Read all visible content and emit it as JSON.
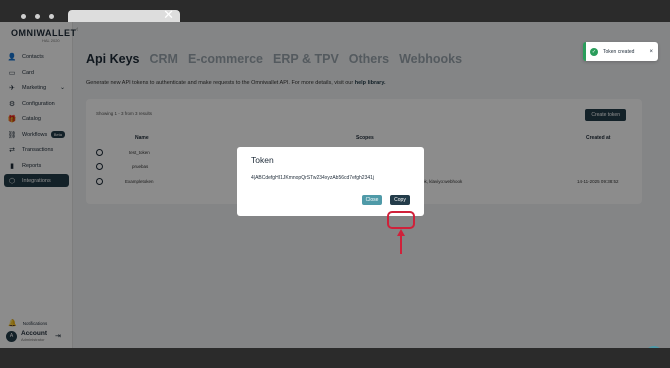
{
  "browser": {
    "tab_close": "✕"
  },
  "sidebar": {
    "logo": "OMNIWALLET",
    "logo_sub": "HAL 2020",
    "collapse": "‹",
    "items": [
      {
        "label": "Contacts",
        "icon": "👤"
      },
      {
        "label": "Card",
        "icon": "▭"
      },
      {
        "label": "Marketing",
        "icon": "✈"
      },
      {
        "label": "Configuration",
        "icon": "⚙"
      },
      {
        "label": "Catalog",
        "icon": "🎁"
      },
      {
        "label": "Workflows",
        "icon": "⛓",
        "badge": "Beta"
      },
      {
        "label": "Transactions",
        "icon": "⇄"
      },
      {
        "label": "Reports",
        "icon": "▮"
      },
      {
        "label": "Integrations",
        "icon": "⬡"
      }
    ],
    "notifications": "Notifications",
    "account_name": "Account",
    "account_role": "Administrator"
  },
  "main": {
    "tabs": [
      "Api Keys",
      "CRM",
      "E-commerce",
      "ERP & TPV",
      "Others",
      "Webhooks"
    ],
    "description": "Generate new API tokens to authenticate and make requests to the Omniwallet API. For more details, visit our ",
    "help_link": "help library.",
    "showing": "Showing 1 - 3 from 3 results",
    "create_token": "Create token",
    "headers": {
      "name": "Name",
      "scopes": "Scopes",
      "created_at": "Created at"
    },
    "rows": [
      {
        "name": "test_token",
        "scopes": "",
        "created": ""
      },
      {
        "name": "pruebas",
        "scopes": "",
        "created": ""
      },
      {
        "name": "Exampletoken",
        "scopes": "ok, klaviyo:webhook",
        "created": "14-11-2025 09:38:52"
      }
    ]
  },
  "toast": {
    "text": "Token created",
    "close": "×"
  },
  "modal": {
    "title": "Token",
    "token": "4|ABCdefgHI1JKmnopQrSTw234xyzAb56cd7efgh2341j",
    "close_label": "Close",
    "copy_label": "Copy"
  },
  "colors": {
    "accent": "#233c4a",
    "teal": "#4f9aa8",
    "highlight": "#d0213a",
    "success": "#2a9d5b"
  }
}
